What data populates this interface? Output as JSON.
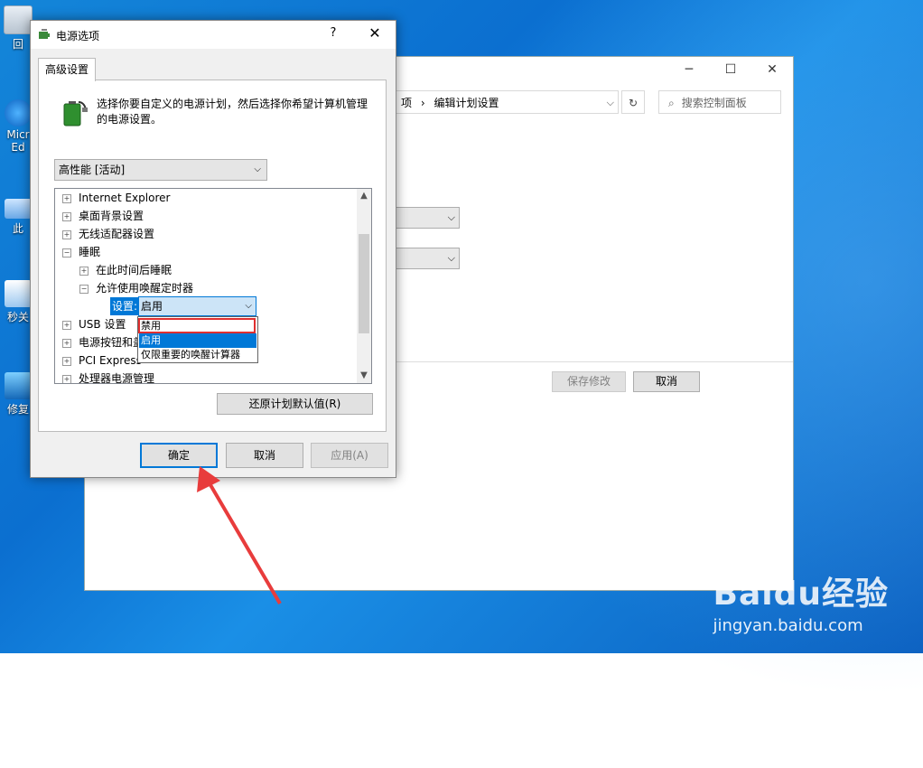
{
  "desktop": {
    "icons": [
      {
        "label": "回"
      },
      {
        "label": "Micr\nEd"
      },
      {
        "label": "此"
      },
      {
        "label": "秒关"
      },
      {
        "label": "修复"
      }
    ]
  },
  "control_panel": {
    "breadcrumb_prefix": "项",
    "breadcrumb_sep": "›",
    "breadcrumb_current": "编辑计划设置",
    "search_placeholder": "搜索控制面板",
    "save_label": "保存修改",
    "cancel_label": "取消",
    "minimize": "─",
    "maximize": "☐",
    "close": "✕"
  },
  "dialog": {
    "title": "电源选项",
    "help": "?",
    "close": "✕",
    "tab": "高级设置",
    "description": "选择你要自定义的电源计划，然后选择你希望计算机管理的电源设置。",
    "plan": "高性能 [活动]",
    "tree": [
      {
        "label": "Internet Explorer",
        "sign": "+"
      },
      {
        "label": "桌面背景设置",
        "sign": "+"
      },
      {
        "label": "无线适配器设置",
        "sign": "+"
      },
      {
        "label": "睡眠",
        "sign": "−"
      },
      {
        "label": "在此时间后睡眠",
        "sign": "+"
      },
      {
        "label": "允许使用唤醒定时器",
        "sign": "−"
      },
      {
        "label": "USB 设置",
        "sign": "+"
      },
      {
        "label": "电源按钮和盖",
        "sign": "+"
      },
      {
        "label": "PCI Express",
        "sign": "+"
      },
      {
        "label": "处理器电源管理",
        "sign": "+"
      }
    ],
    "setting_label": "设置:",
    "setting_value": "启用",
    "dropdown_options": [
      "禁用",
      "启用",
      "仅限重要的唤醒计算器"
    ],
    "restore": "还原计划默认值(R)",
    "ok": "确定",
    "cancel": "取消",
    "apply": "应用(A)"
  },
  "watermark": {
    "brand": "Baidu经验",
    "url": "jingyan.baidu.com"
  }
}
